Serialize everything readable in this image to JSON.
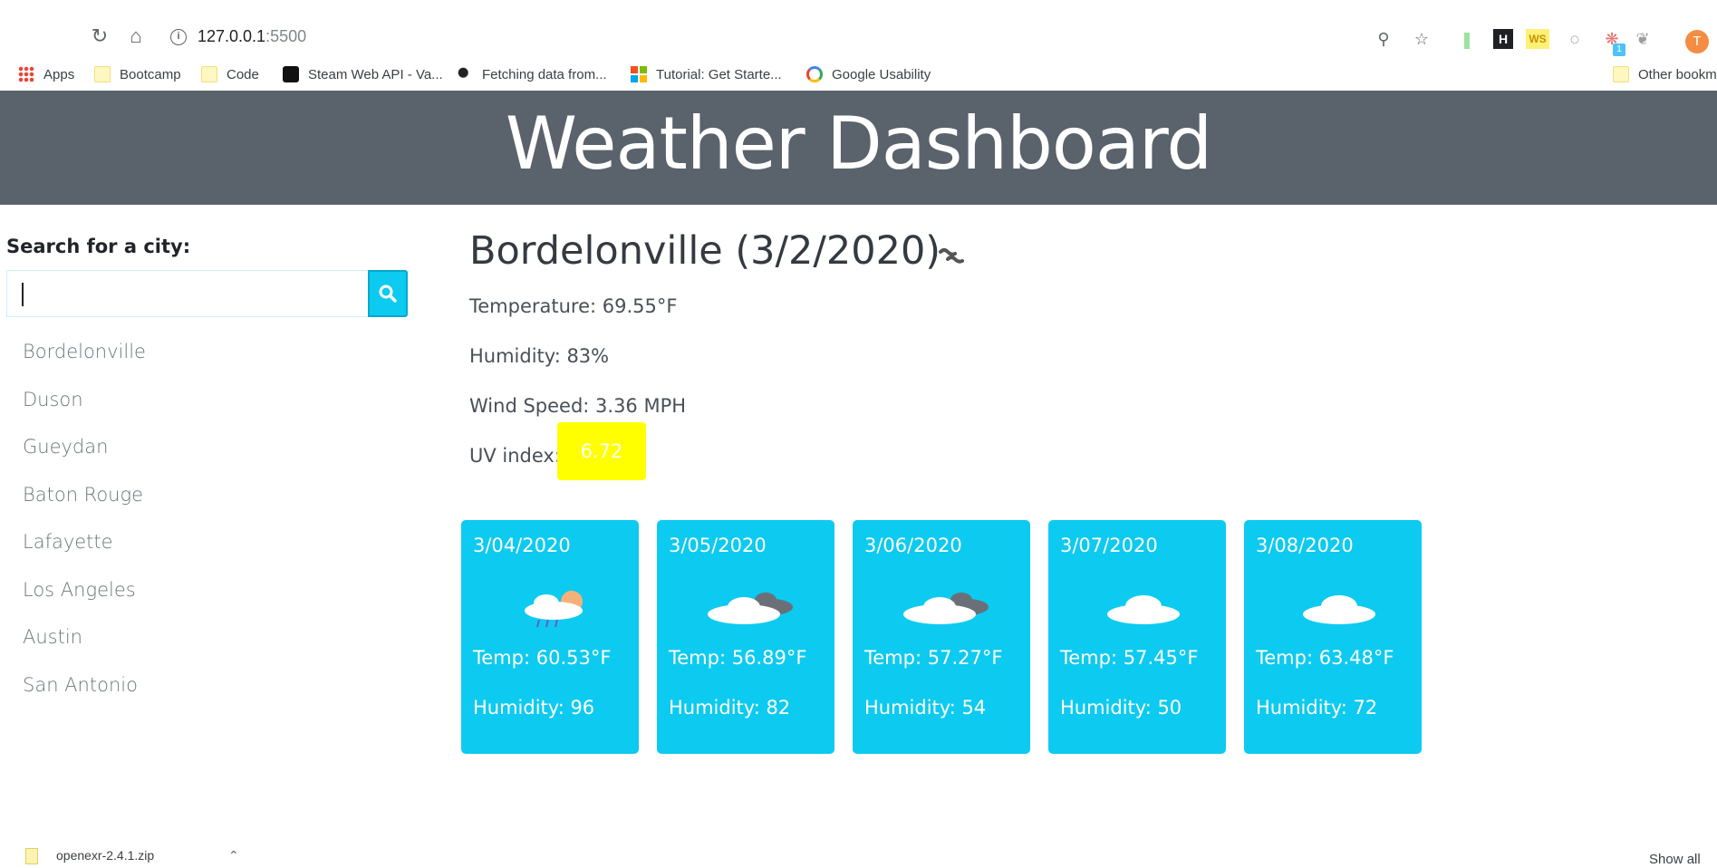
{
  "browser": {
    "url_host": "127.0.0.1",
    "url_port": ":5500",
    "profile_initial": "T",
    "extension_badge": "1",
    "bookmarks": [
      {
        "label": "Apps",
        "icon": "apps-grid-icon"
      },
      {
        "label": "Bootcamp",
        "icon": "folder-icon"
      },
      {
        "label": "Code",
        "icon": "folder-icon"
      },
      {
        "label": "Steam Web API - Va...",
        "icon": "steam-icon"
      },
      {
        "label": "Fetching data from...",
        "icon": "bird-icon"
      },
      {
        "label": "Tutorial: Get Starte...",
        "icon": "microsoft-icon"
      },
      {
        "label": "Google Usability",
        "icon": "google-icon"
      }
    ],
    "other_bookmarks": "Other bookm"
  },
  "header": {
    "title": "Weather Dashboard"
  },
  "sidebar": {
    "search_label": "Search for a city:",
    "search_value": "",
    "cities": [
      "Bordelonville",
      "Duson",
      "Gueydan",
      "Baton Rouge",
      "Lafayette",
      "Los Angeles",
      "Austin",
      "San Antonio"
    ]
  },
  "current": {
    "title": "Bordelonville (3/2/2020)",
    "icon": "mist-icon",
    "temperature": "Temperature: 69.55°F",
    "humidity": "Humidity: 83%",
    "wind": "Wind Speed: 3.36 MPH",
    "uv_label": "UV index:",
    "uv_value": "6.72",
    "uv_color": "#ffff00"
  },
  "forecast": [
    {
      "date": "3/04/2020",
      "icon": "rain-sun-cloud-icon",
      "temp": "Temp: 60.53°F",
      "humidity": "Humidity: 96"
    },
    {
      "date": "3/05/2020",
      "icon": "broken-clouds-icon",
      "temp": "Temp: 56.89°F",
      "humidity": "Humidity: 82"
    },
    {
      "date": "3/06/2020",
      "icon": "broken-clouds-icon",
      "temp": "Temp: 57.27°F",
      "humidity": "Humidity: 54"
    },
    {
      "date": "3/07/2020",
      "icon": "cloud-icon",
      "temp": "Temp: 57.45°F",
      "humidity": "Humidity: 50"
    },
    {
      "date": "3/08/2020",
      "icon": "cloud-icon",
      "temp": "Temp: 63.48°F",
      "humidity": "Humidity: 72"
    }
  ],
  "downloads": {
    "file": "openexr-2.4.1.zip",
    "show_all": "Show all"
  },
  "colors": {
    "header_bg": "#5a636b",
    "card_bg": "#0dcaf0",
    "uv_badge": "#ffff00"
  }
}
